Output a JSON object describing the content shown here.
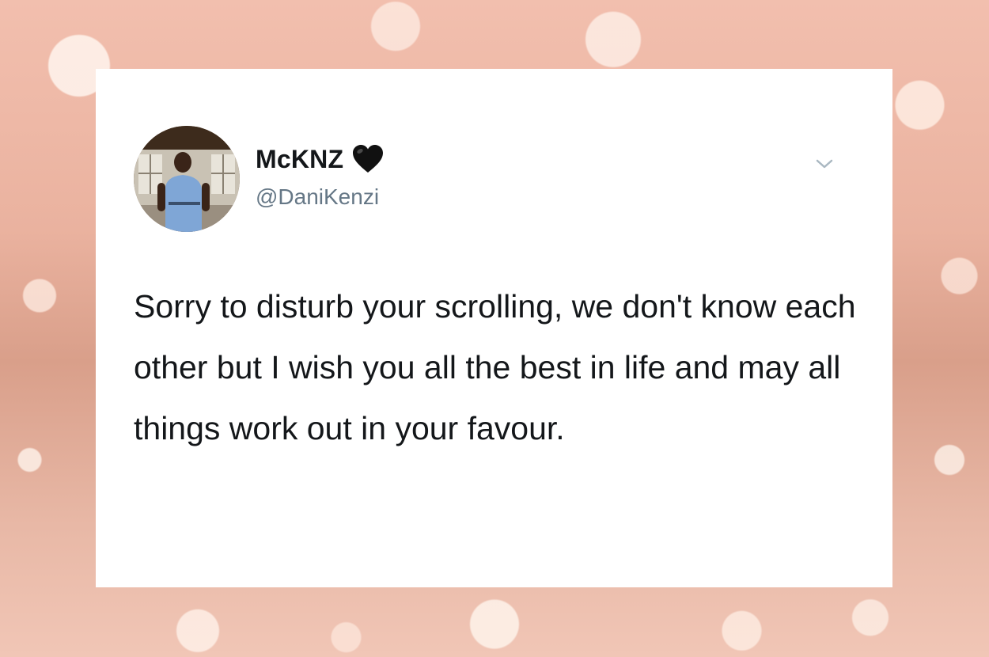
{
  "tweet": {
    "display_name": "McKNZ",
    "handle": "@DaniKenzi",
    "text": "Sorry to disturb your scrolling, we don't know each other but I wish you all the best in life and may all things work out in your favour."
  },
  "icons": {
    "name_badge": "black-heart-icon",
    "menu": "chevron-down-icon",
    "avatar": "profile-photo"
  },
  "colors": {
    "card_background": "#ffffff",
    "text_primary": "#14171a",
    "text_secondary": "#657786",
    "chevron": "#aab8c2",
    "page_background": "#eab29f"
  }
}
